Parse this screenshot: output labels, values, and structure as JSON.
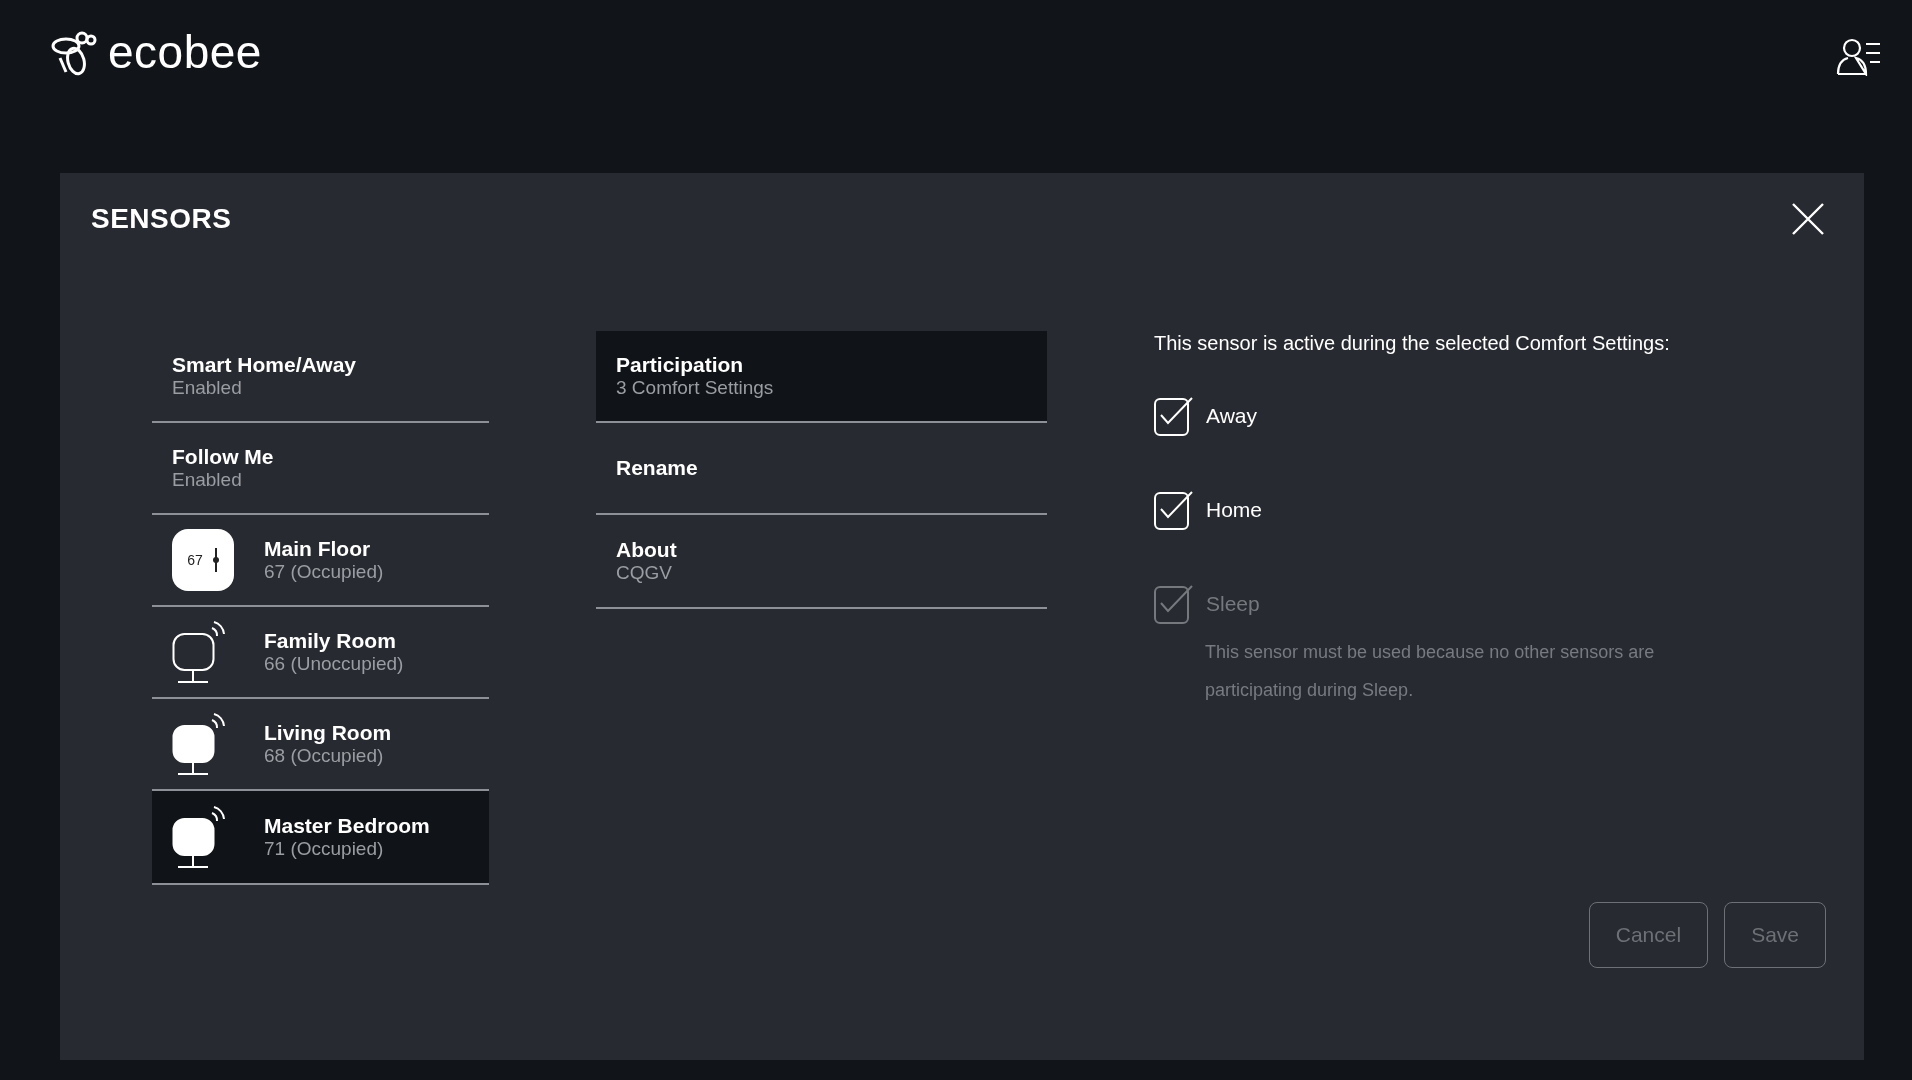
{
  "header": {
    "brand": "ecobee"
  },
  "panel": {
    "title": "SENSORS"
  },
  "sensors": [
    {
      "kind": "setting",
      "title": "Smart Home/Away",
      "subtitle": "Enabled",
      "selected": false
    },
    {
      "kind": "setting",
      "title": "Follow Me",
      "subtitle": "Enabled",
      "selected": false
    },
    {
      "kind": "thermostat",
      "title": "Main Floor",
      "subtitle": "67 (Occupied)",
      "icon_text": "67",
      "selected": false
    },
    {
      "kind": "sensor",
      "title": "Family Room",
      "subtitle": "66 (Unoccupied)",
      "occupied": false,
      "selected": false
    },
    {
      "kind": "sensor",
      "title": "Living Room",
      "subtitle": "68 (Occupied)",
      "occupied": true,
      "selected": false
    },
    {
      "kind": "sensor",
      "title": "Master Bedroom",
      "subtitle": "71 (Occupied)",
      "occupied": true,
      "selected": true
    }
  ],
  "options": [
    {
      "title": "Participation",
      "subtitle": "3 Comfort Settings",
      "selected": true
    },
    {
      "title": "Rename",
      "selected": false
    },
    {
      "title": "About",
      "subtitle": "CQGV",
      "selected": false
    }
  ],
  "participation": {
    "intro": "This sensor is active during the selected Comfort Settings:",
    "comfort_settings": [
      {
        "label": "Away",
        "checked": true,
        "disabled": false
      },
      {
        "label": "Home",
        "checked": true,
        "disabled": false
      },
      {
        "label": "Sleep",
        "checked": true,
        "disabled": true,
        "note": "This sensor must be used because no other sensors are participating during Sleep."
      }
    ]
  },
  "buttons": [
    {
      "label": "Cancel",
      "disabled": true
    },
    {
      "label": "Save",
      "disabled": true
    }
  ]
}
